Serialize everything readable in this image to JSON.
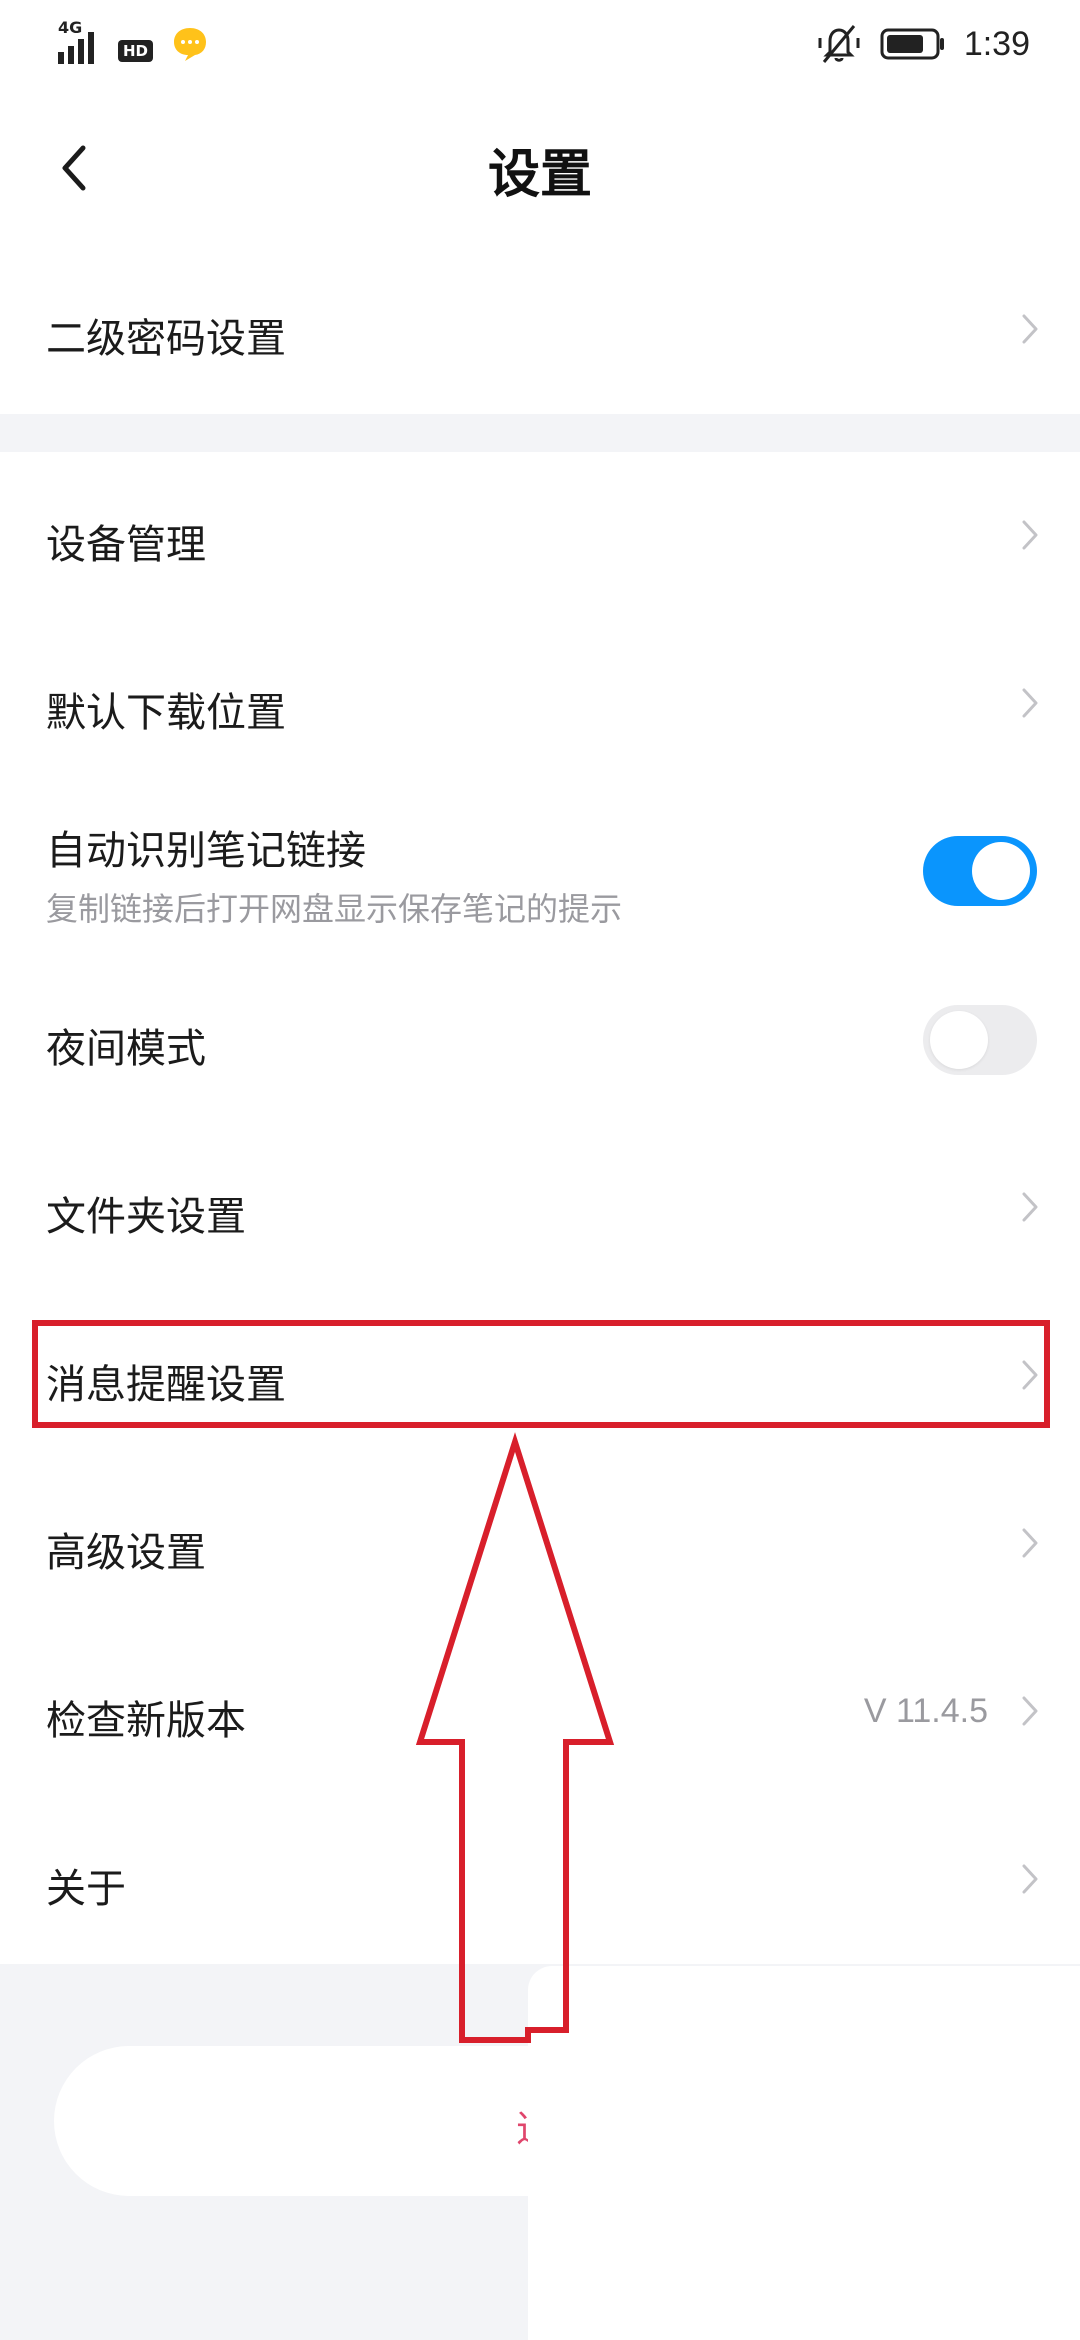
{
  "status_bar": {
    "network": "4G",
    "hd": "HD",
    "time": "1:39"
  },
  "header": {
    "title": "设置"
  },
  "settings": {
    "secondary_password": "二级密码设置",
    "device_management": "设备管理",
    "default_download_location": "默认下载位置",
    "auto_detect_note_links": {
      "label": "自动识别笔记链接",
      "description": "复制链接后打开网盘显示保存笔记的提示",
      "enabled": true
    },
    "night_mode": {
      "label": "夜间模式",
      "enabled": false
    },
    "folder_settings": "文件夹设置",
    "message_reminder_settings": "消息提醒设置",
    "advanced_settings": "高级设置",
    "check_new_version": {
      "label": "检查新版本",
      "version": "V 11.4.5"
    },
    "about": "关于"
  },
  "logout": {
    "label": "退出"
  },
  "colors": {
    "accent": "#0a95fd",
    "annotation": "#d81f2b",
    "logout_text": "#e0466c"
  },
  "icons": [
    "signal-icon",
    "chat-bubble-icon",
    "mute-icon",
    "battery-icon",
    "back-arrow-icon",
    "chevron-right-icon",
    "annotation-arrow-icon"
  ]
}
